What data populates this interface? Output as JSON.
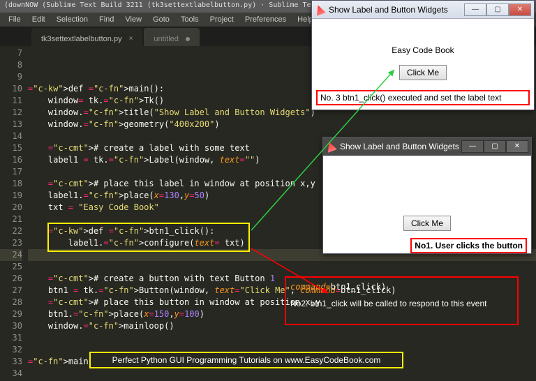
{
  "app": {
    "title_prefix": "(downNOW (Sublime Text Build 3211 (tk3settextlabelbutton.py) · Sublime Text (UNREGISTERED)"
  },
  "menu": [
    "File",
    "Edit",
    "Selection",
    "Find",
    "View",
    "Goto",
    "Tools",
    "Project",
    "Preferences",
    "Help"
  ],
  "tabs": [
    {
      "label": "tk3settextlabelbutton.py",
      "active": true
    },
    {
      "label": "untitled",
      "active": false
    }
  ],
  "lines_start": 7,
  "lines_end": 34,
  "code_lines": [
    "",
    "",
    "",
    "def main():",
    "    window= tk.Tk()",
    "    window.title(\"Show Label and Button Widgets\")",
    "    window.geometry(\"400x200\")",
    "",
    "    # create a label with some text",
    "    label1 = tk.Label(window, text=\"\")",
    "",
    "    # place this label in window at position x,y",
    "    label1.place(x=130,y=50)",
    "    txt = \"Easy Code Book\"",
    "",
    "    def btn1_click():",
    "        label1.configure(text = txt)",
    "",
    "",
    "    # create a button with text Button 1",
    "    btn1 = tk.Button(window, text=\"Click Me\", command=btn1_click)",
    "    # place this button in window at position x,y",
    "    btn1.place(x=150,y=100)",
    "    window.mainloop()",
    "",
    "",
    "main()",
    ""
  ],
  "tk_window1": {
    "title": "Show Label and Button Widgets",
    "label_text": "Easy Code Book",
    "button_label": "Click Me",
    "result_text": "No. 3 btn1_click() executed and set the label text"
  },
  "tk_window2": {
    "title": "Show Label and Button Widgets",
    "button_label": "Click Me",
    "note_text": "No1. User clicks the button"
  },
  "callout": {
    "no2_line1": "No2. btn1_click will be called to respond to this event",
    "no2_cmd_param": "command=",
    "no2_cmd_val": "btn1_click)",
    "footer": "Perfect Python GUI Programming Tutorials on www.EasyCodeBook.com"
  }
}
